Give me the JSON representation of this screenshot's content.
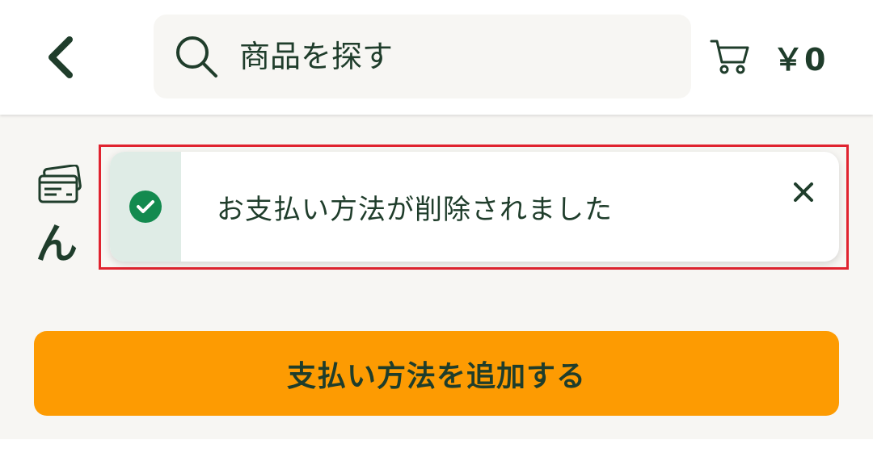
{
  "header": {
    "back_icon": "chevron-left-icon",
    "search": {
      "icon": "search-icon",
      "placeholder": "商品を探す"
    },
    "cart": {
      "icon": "cart-icon",
      "amount": "￥0"
    }
  },
  "main": {
    "card_icon": "credit-card-icon",
    "partial_text": "ん",
    "toast": {
      "status_icon": "check-circle-icon",
      "message": "お支払い方法が削除されました",
      "close_icon": "close-icon"
    },
    "add_button_label": "支払い方法を追加する"
  },
  "colors": {
    "brand_text": "#1f3d2b",
    "accent_orange": "#fd9b02",
    "success_green": "#138a4f",
    "toast_strip": "#dfece6",
    "highlight_red": "#e0232f",
    "background": "#f7f6f3"
  }
}
